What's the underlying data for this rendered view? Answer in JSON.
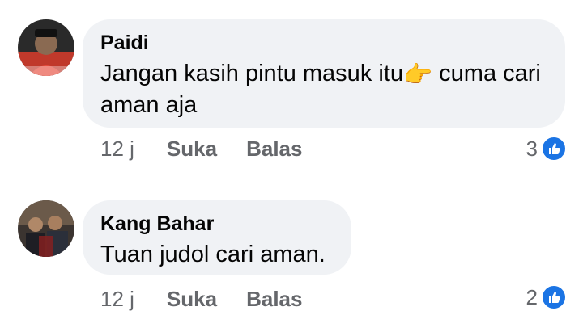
{
  "comments": [
    {
      "author": "Paidi",
      "text_before_emoji": "Jangan kasih pintu masuk itu",
      "emoji": "👉",
      "text_after_emoji": " cuma cari aman aja",
      "time": "12 j",
      "like_label": "Suka",
      "reply_label": "Balas",
      "reaction_count": "3",
      "reaction_icon": "like-icon"
    },
    {
      "author": "Kang Bahar",
      "text_before_emoji": "Tuan judol cari aman.",
      "emoji": "",
      "text_after_emoji": "",
      "time": "12 j",
      "like_label": "Suka",
      "reply_label": "Balas",
      "reaction_count": "2",
      "reaction_icon": "like-icon"
    }
  ],
  "colors": {
    "bubble_bg": "#f0f2f5",
    "meta_text": "#65676b",
    "like_blue": "#1b74e4"
  }
}
